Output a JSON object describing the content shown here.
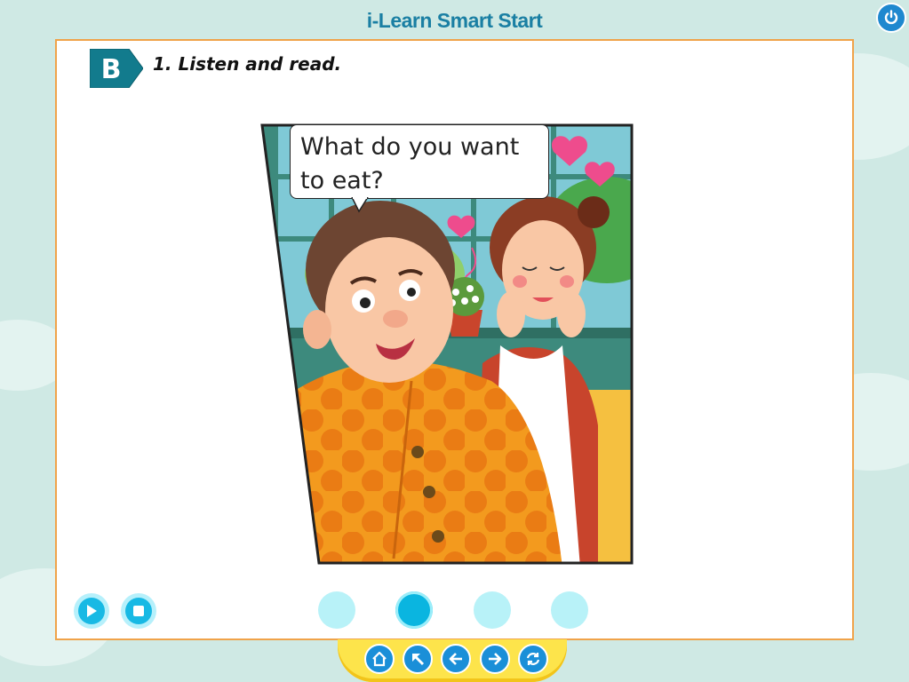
{
  "app": {
    "title": "i-Learn Smart Start"
  },
  "header": {
    "power_icon": "power-icon"
  },
  "section": {
    "badge": "B",
    "instruction": "1. Listen and read."
  },
  "comic": {
    "speech_line1": "What do you want",
    "speech_line2": "to eat?"
  },
  "controls": {
    "play_icon": "play-icon",
    "stop_icon": "stop-icon"
  },
  "pagination": {
    "pages": 4,
    "active_index": 1
  },
  "nav": {
    "icons": [
      "home-icon",
      "top-left-arrow-icon",
      "back-arrow-icon",
      "forward-arrow-icon",
      "refresh-icon"
    ]
  },
  "colors": {
    "panel_border": "#f0a34a",
    "accent": "#18b9e4",
    "nav_blue": "#1a8fd8",
    "bottom_bar": "#fde44b"
  }
}
